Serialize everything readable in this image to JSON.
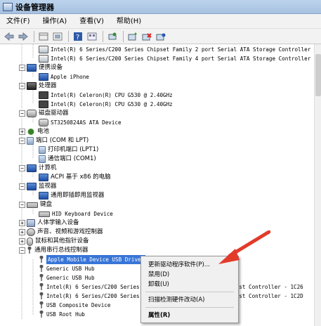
{
  "window": {
    "title": "设备管理器"
  },
  "menu": [
    "文件(F)",
    "操作(A)",
    "查看(V)",
    "帮助(H)"
  ],
  "toolbar": {
    "icons": [
      "back-icon",
      "forward-icon",
      "properties-grid-icon",
      "show-hide-icon",
      "help-icon",
      "view-icon",
      "scan-hardware-icon",
      "update-driver-icon",
      "uninstall-icon",
      "disable-icon"
    ]
  },
  "tree": {
    "sata1": "Intel(R) 6 Series/C200 Series Chipset Family 2 port Serial ATA Storage Controller",
    "sata2": "Intel(R) 6 Series/C200 Series Chipset Family 4 port Serial ATA Storage Controller",
    "portable": "便携设备",
    "iphone": "Apple iPhone",
    "processors": "处理器",
    "cpu1": "Intel(R) Celeron(R) CPU G530 @ 2.40GHz",
    "cpu2": "Intel(R) Celeron(R) CPU G530 @ 2.40GHz",
    "disks": "磁盘驱动器",
    "disk1": "ST3250824AS ATA Device",
    "battery": "电池",
    "ports": "端口 (COM 和 LPT)",
    "lpt": "打印机端口 (LPT1)",
    "com": "通信端口 (COM1)",
    "computer": "计算机",
    "acpi": "ACPI 基于 x86 的电脑",
    "monitors": "监视器",
    "pnp_monitor": "通用即插即用监视器",
    "keyboards": "键盘",
    "hid_kbd": "HID Keyboard Device",
    "hid": "人体学输入设备",
    "sound": "声音、视频和游戏控制器",
    "mice": "鼠标和其他指针设备",
    "usb_ctrl": "通用串行总线控制器",
    "usb1": "Apple Mobile Device USB Driver",
    "usb2": "Generic USB Hub",
    "usb3": "Generic USB Hub",
    "usb4": "Intel(R) 6 Series/C200 Series Chipset Family USB Enhanced Host Controller - 1C26",
    "usb5": "Intel(R) 6 Series/C200 Series Chipset Family USB Enhanced Host Controller - 1C2D",
    "usb6": "USB Composite Device",
    "usb7": "USB Root Hub"
  },
  "context_menu": {
    "update": "更新驱动程序软件(P)...",
    "disable": "禁用(D)",
    "uninstall": "卸载(U)",
    "scan": "扫描检测硬件改动(A)",
    "properties": "属性(R)"
  },
  "colors": {
    "selection": "#3875d7",
    "arrow": "#e23b2a"
  }
}
